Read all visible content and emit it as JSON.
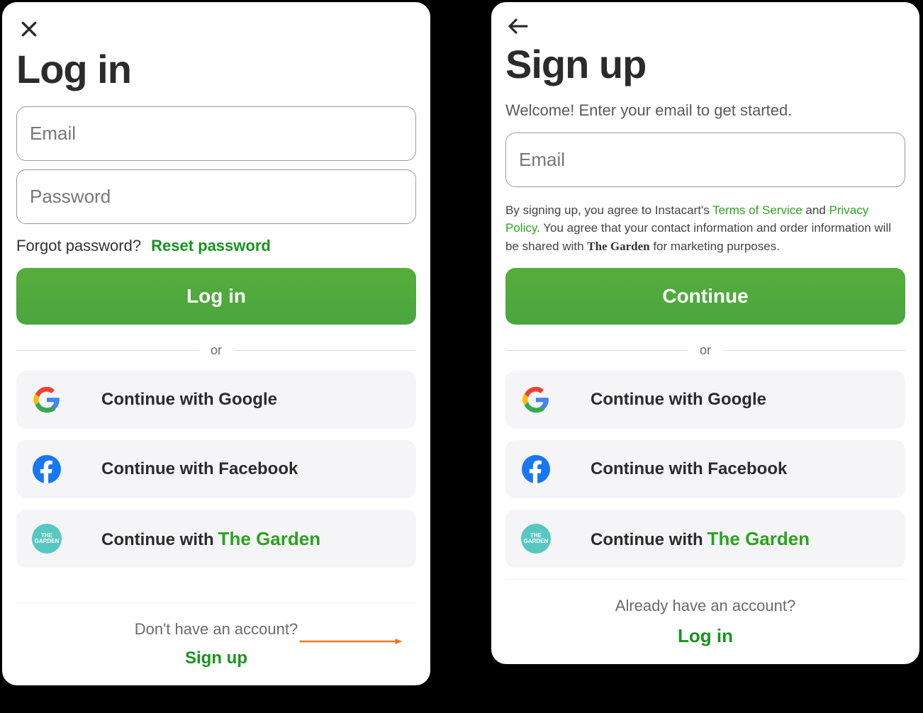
{
  "login": {
    "title": "Log in",
    "email_placeholder": "Email",
    "password_placeholder": "Password",
    "forgot_text": "Forgot password?",
    "reset_link": "Reset password",
    "submit": "Log in",
    "or": "or",
    "google": "Continue with Google",
    "facebook": "Continue with Facebook",
    "partner_prefix": "Continue with",
    "partner_brand": "The Garden",
    "footer_q": "Don't have an account?",
    "footer_action": "Sign up"
  },
  "signup": {
    "title": "Sign up",
    "subtitle": "Welcome! Enter your email to get started.",
    "email_placeholder": "Email",
    "legal_pre": "By signing up, you agree to Instacart's ",
    "tos": "Terms of Service",
    "legal_and": " and ",
    "privacy": "Privacy Policy",
    "legal_mid": ". You agree that your contact information and order information will be shared with ",
    "partner_inline": "The Garden",
    "legal_post": " for marketing purposes.",
    "submit": "Continue",
    "or": "or",
    "google": "Continue with Google",
    "facebook": "Continue with Facebook",
    "partner_prefix": "Continue with",
    "partner_brand": "The Garden",
    "footer_q": "Already have an account?",
    "footer_action": "Log in"
  },
  "icons": {
    "close": "close-icon",
    "back": "back-arrow-icon",
    "google": "google-logo-icon",
    "facebook": "facebook-logo-icon",
    "garden": "garden-logo-icon"
  },
  "colors": {
    "primary_green": "#4aa63f",
    "link_green": "#17941d",
    "brand_green": "#2aa31f",
    "arrow_orange": "#e87a1f"
  }
}
